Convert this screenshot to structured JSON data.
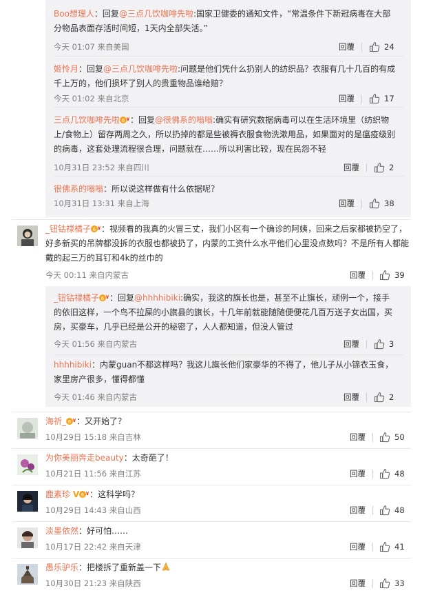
{
  "reply_label": "回复",
  "actions": {
    "reply": "回覆"
  },
  "thread1": [
    {
      "author": "Boo想理人",
      "reply_word": "：回复",
      "mention": "@三点几饮咖啡先啦",
      "text": ":国家卫健委的通知文件，“常温条件下新冠病毒在大部分物品表面存活时间短，1天内全部失活。”",
      "time": "今天 01:07 来自美国",
      "likes": "24"
    },
    {
      "author": "姬怜月",
      "reply_word": "：回复",
      "mention": "@三点几饮咖啡先啦",
      "text": ":问题是他们凭什么扔别人的纺织品？衣服有几十几百的有成千上万的，他们损坏了别人的贵重物品谁给赔？",
      "time": "今天 01:02 来自北京",
      "likes": "17"
    },
    {
      "author": "三点几饮咖啡先啦",
      "badge": true,
      "reply_word": "：回复",
      "mention": "@很佛系的嗡嗡",
      "text": ":确实有研究数据病毒可以在生活环境里（纺织物上/食物上）留存两周之久，所以扔掉的都是些被褥衣服食物洗漱用品，如果面对的是瘟疫级别的病毒，这套处理流程很合理，问题就在……所以利害比较，现在民怨不轻",
      "time": "10月31日 23:52 来自四川",
      "likes": "2"
    },
    {
      "author": "很佛系的嗡嗡",
      "text": "：所以说这样做有什么依据呢？",
      "time": "10月31日 13:31 来自上海",
      "likes": "38"
    }
  ],
  "main_comment": {
    "author": "_钮钴禄橘子",
    "badge": true,
    "text": "：视频看的我真的火冒三丈，我们小区有一个确诊的阿姨，回来之后家都被扔空了，好多新买的吊牌都没拆的衣服也都被扔了，内蒙的工资什么水平他们心里没点数吗？不是所有人都能戴的起三万的耳钉和4k的丝巾的",
    "time": "今天 00:11 来自内蒙古",
    "likes": "39"
  },
  "thread2": [
    {
      "author": "_钮钴禄橘子",
      "badge": true,
      "reply_word": "：回复",
      "mention": "@hhhhibiki",
      "text": ":确实，我这的旗长也是，甚至不止旗长，顽例一个，接手的依旧这样，一个鸟不拉屎的小旗县的旗长，十几年前就能随随便便花几百万送子女出国，买房，买豪车，几乎已经是公开的秘密了，人人都知道，但没人管过",
      "time": "今天 01:56 来自内蒙古",
      "likes": "3"
    },
    {
      "author": "hhhhibiki",
      "text": "：内蒙guan不都这样吗？我这儿旗长他们家豪华的不得了，他儿子从小锦衣玉食，家里房产很多，懂得都懂",
      "time": "今天 01:46 来自内蒙古",
      "likes": "2"
    }
  ],
  "comments": [
    {
      "author": "海祈_",
      "badge": true,
      "text": "：又开始了？",
      "time": "10月29日 15:18 来自吉林",
      "likes": "50"
    },
    {
      "author": "为你美丽奔走beauty",
      "text": "：太奇葩了！",
      "time": "10月21日 11:56 来自江苏",
      "likes": "48"
    },
    {
      "author": "鹿素珍",
      "vbadge": "V",
      "badge": true,
      "text": "：这科学吗？",
      "time": "10月29日 14:43 来自山西",
      "likes": "48"
    },
    {
      "author": "淡墨依然",
      "text": "：好可怕……",
      "time": "10月17日 22:42 来自天津",
      "likes": "41"
    },
    {
      "author": "愚乐驴乐",
      "text": "：把楼拆了重新盖一下",
      "time": "10月30日 21:23 来自陕西",
      "likes": "33"
    }
  ],
  "colors": {
    "link": "#eb7350",
    "sub_bg": "#f2f2f5",
    "meta": "#808080"
  }
}
